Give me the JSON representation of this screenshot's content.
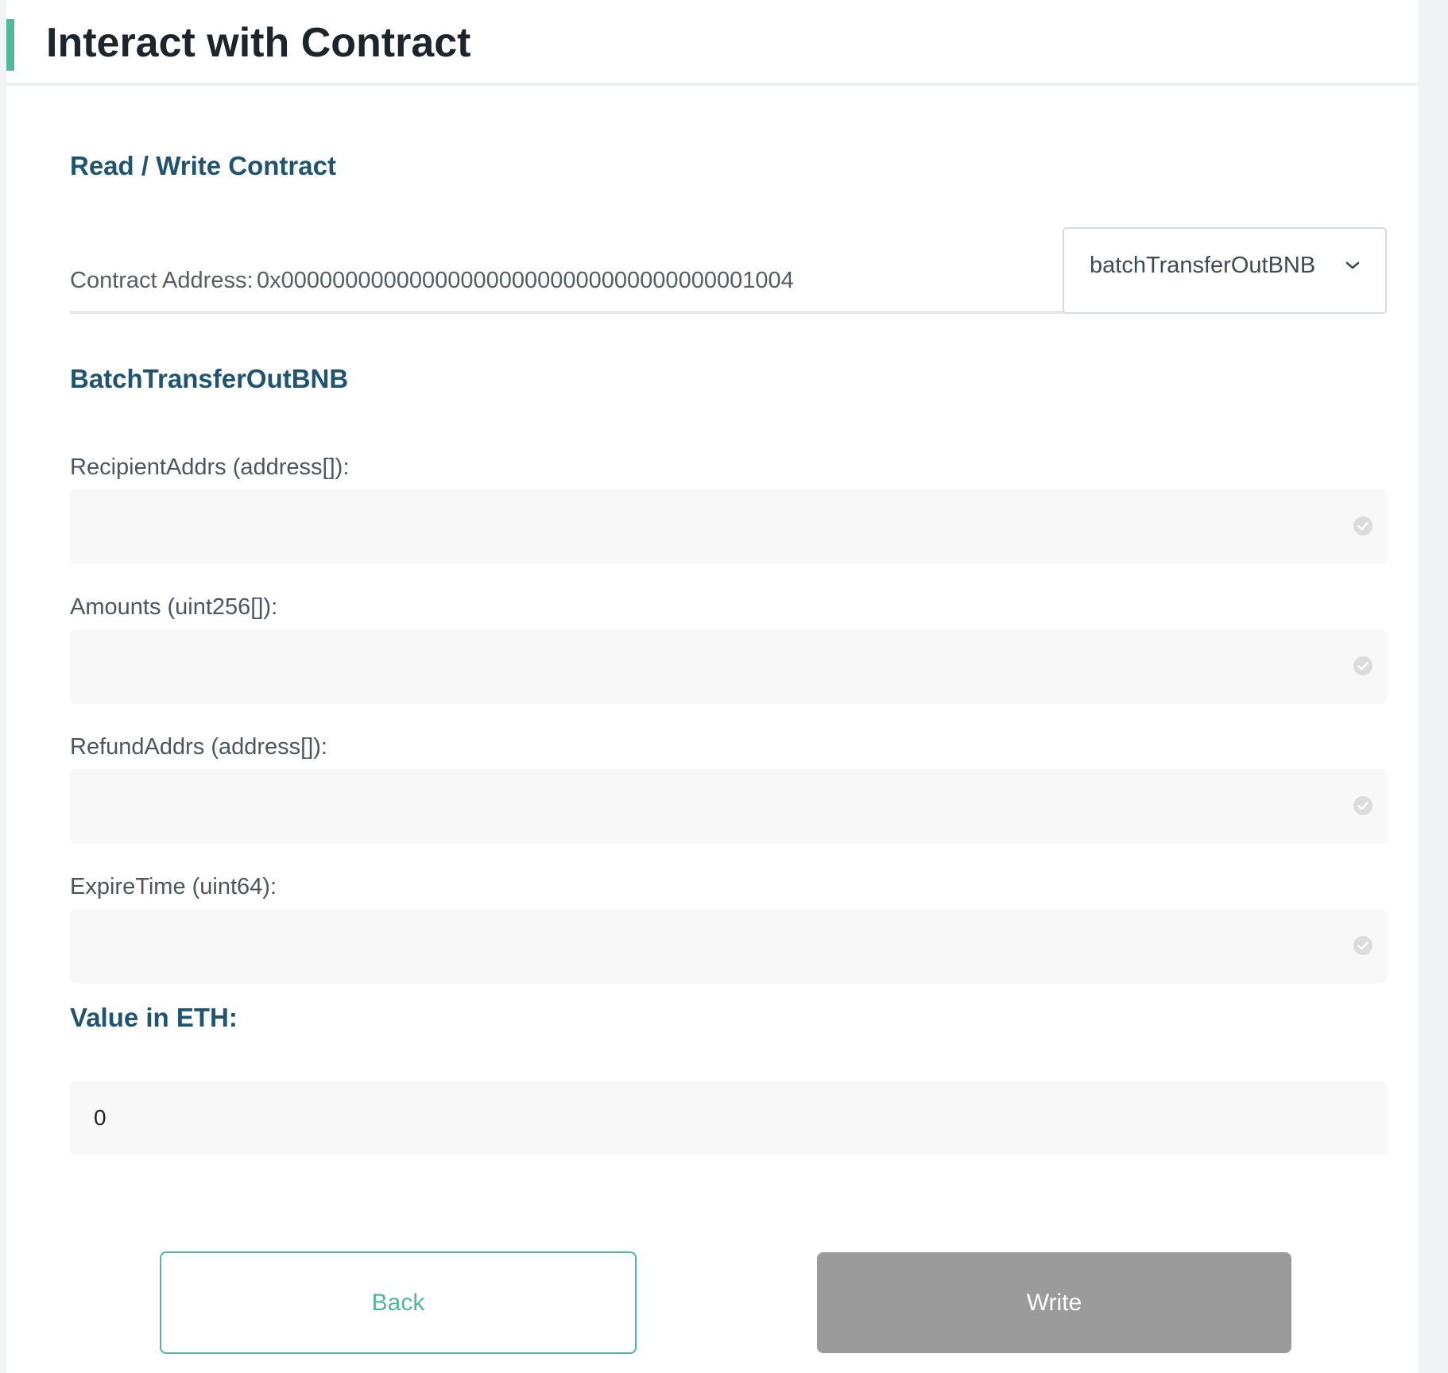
{
  "header": {
    "title": "Interact with Contract",
    "accent_color": "#52b89a"
  },
  "section": {
    "title": "Read / Write Contract"
  },
  "contract": {
    "address_label": "Contract Address:",
    "address_value": "0x0000000000000000000000000000000000001004"
  },
  "function_select": {
    "selected": "batchTransferOutBNB",
    "icon": "chevron-down-icon"
  },
  "function": {
    "title": "BatchTransferOutBNB",
    "fields": [
      {
        "label": "RecipientAddrs (address[]):",
        "value": "",
        "icon": "check-circle-icon"
      },
      {
        "label": "Amounts (uint256[]):",
        "value": "",
        "icon": "check-circle-icon"
      },
      {
        "label": "RefundAddrs (address[]):",
        "value": "",
        "icon": "check-circle-icon"
      },
      {
        "label": "ExpireTime (uint64):",
        "value": "",
        "icon": "check-circle-icon"
      }
    ]
  },
  "value": {
    "label": "Value in ETH:",
    "amount": "0"
  },
  "buttons": {
    "back": "Back",
    "write": "Write",
    "back_color": "#52b89a",
    "write_bg": "#9b9b9b"
  }
}
